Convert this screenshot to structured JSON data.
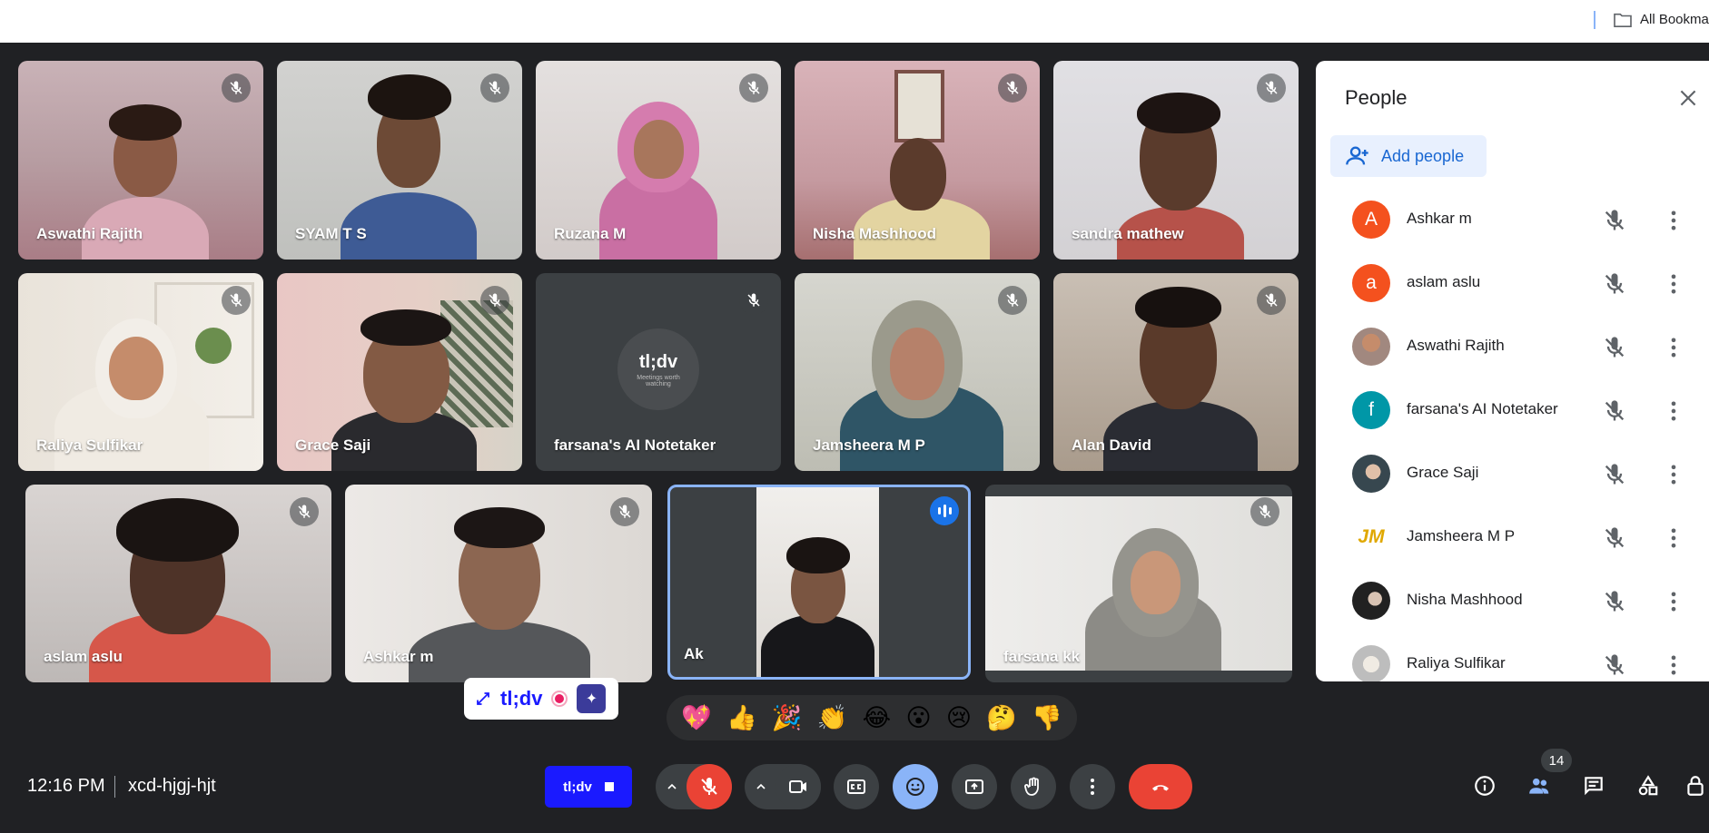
{
  "bookmarks": {
    "label": "All Bookma"
  },
  "tiles": [
    {
      "name": "Aswathi Rajith"
    },
    {
      "name": "SYAM T S"
    },
    {
      "name": "Ruzana M"
    },
    {
      "name": "Nisha Mashhood"
    },
    {
      "name": "sandra mathew"
    },
    {
      "name": "Raliya Sulfikar"
    },
    {
      "name": "Grace Saji"
    },
    {
      "name": "farsana's AI Notetaker",
      "logo": "tl;dv",
      "tagline": "Meetings worth watching"
    },
    {
      "name": "Jamsheera M P"
    },
    {
      "name": "Alan David"
    },
    {
      "name": "aslam aslu"
    },
    {
      "name": "Ashkar m"
    },
    {
      "name": "Ak"
    },
    {
      "name": "farsana kk"
    }
  ],
  "people": {
    "title": "People",
    "add_label": "Add people",
    "list": [
      {
        "name": "Ashkar m",
        "initial": "A",
        "color": "#f4511e"
      },
      {
        "name": "aslam aslu",
        "initial": "a",
        "color": "#f4511e"
      },
      {
        "name": "Aswathi Rajith",
        "initial": "",
        "color": "#a1887f"
      },
      {
        "name": "farsana's AI Notetaker",
        "initial": "f",
        "color": "#0097a7"
      },
      {
        "name": "Grace Saji",
        "initial": "",
        "color": "#37474f"
      },
      {
        "name": "Jamsheera M P",
        "initial": "JM",
        "color": "#ffffff"
      },
      {
        "name": "Nisha Mashhood",
        "initial": "",
        "color": "#212121"
      },
      {
        "name": "Raliya Sulfikar",
        "initial": "",
        "color": "#bdbdbd"
      }
    ]
  },
  "tldv_float": {
    "logo": "tl;dv"
  },
  "reactions": [
    "💖",
    "👍",
    "🎉",
    "👏",
    "😂",
    "😮",
    "😢",
    "🤔",
    "👎"
  ],
  "bottom": {
    "time": "12:16 PM",
    "meeting_code": "xcd-hjgj-hjt",
    "tldv_button": "tl;dv",
    "people_count": "14"
  },
  "colors": {
    "accent": "#1a73e8",
    "end_call": "#ea4335",
    "tldv": "#1a1aff"
  }
}
